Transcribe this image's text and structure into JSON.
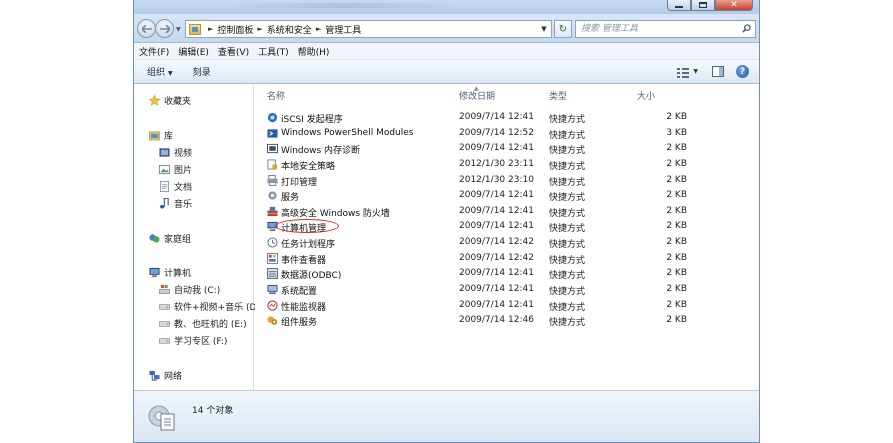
{
  "window": {
    "controls": {
      "minimize_icon": "minimize-icon",
      "maximize_icon": "maximize-icon",
      "close_icon": "close-icon",
      "close_glyph": "✕"
    }
  },
  "address": {
    "crumbs": [
      "控制面板",
      "系统和安全",
      "管理工具"
    ],
    "refresh_glyph": "↻"
  },
  "search": {
    "placeholder": "搜索 管理工具"
  },
  "menu": [
    "文件(F)",
    "编辑(E)",
    "查看(V)",
    "工具(T)",
    "帮助(H)"
  ],
  "toolbar": {
    "organize": "组织",
    "organize_arrow": "▼",
    "burn": "刻录",
    "view_arrow": "▼",
    "help_glyph": "?"
  },
  "sidebar": {
    "favorites": "收藏夹",
    "libraries": "库",
    "library_items": [
      "视频",
      "图片",
      "文档",
      "音乐"
    ],
    "homegroup": "家庭组",
    "computer": "计算机",
    "drives": [
      "自动我 (C:)",
      "软件+视频+音乐 (D",
      "教、也旺机的 (E:)",
      "学习专区 (F:)"
    ],
    "network": "网络"
  },
  "columns": {
    "name": "名称",
    "date": "修改日期",
    "type": "类型",
    "size": "大小",
    "sort_arrow": "▲"
  },
  "files": [
    {
      "name": "iSCSI 发起程序",
      "date": "2009/7/14 12:41",
      "type": "快捷方式",
      "size": "2 KB",
      "icon": "iscsi-icon"
    },
    {
      "name": "Windows PowerShell Modules",
      "date": "2009/7/14 12:52",
      "type": "快捷方式",
      "size": "3 KB",
      "icon": "powershell-icon"
    },
    {
      "name": "Windows 内存诊断",
      "date": "2009/7/14 12:41",
      "type": "快捷方式",
      "size": "2 KB",
      "icon": "memory-diagnostic-icon"
    },
    {
      "name": "本地安全策略",
      "date": "2012/1/30 23:11",
      "type": "快捷方式",
      "size": "2 KB",
      "icon": "security-policy-icon"
    },
    {
      "name": "打印管理",
      "date": "2012/1/30 23:10",
      "type": "快捷方式",
      "size": "2 KB",
      "icon": "printer-icon"
    },
    {
      "name": "服务",
      "date": "2009/7/14 12:41",
      "type": "快捷方式",
      "size": "2 KB",
      "icon": "services-gear-icon"
    },
    {
      "name": "高级安全 Windows 防火墙",
      "date": "2009/7/14 12:41",
      "type": "快捷方式",
      "size": "2 KB",
      "icon": "firewall-icon"
    },
    {
      "name": "计算机管理",
      "date": "2009/7/14 12:41",
      "type": "快捷方式",
      "size": "2 KB",
      "icon": "computer-management-icon"
    },
    {
      "name": "任务计划程序",
      "date": "2009/7/14 12:42",
      "type": "快捷方式",
      "size": "2 KB",
      "icon": "task-scheduler-icon"
    },
    {
      "name": "事件查看器",
      "date": "2009/7/14 12:42",
      "type": "快捷方式",
      "size": "2 KB",
      "icon": "event-viewer-icon"
    },
    {
      "name": "数据源(ODBC)",
      "date": "2009/7/14 12:41",
      "type": "快捷方式",
      "size": "2 KB",
      "icon": "odbc-icon"
    },
    {
      "name": "系统配置",
      "date": "2009/7/14 12:41",
      "type": "快捷方式",
      "size": "2 KB",
      "icon": "system-config-icon"
    },
    {
      "name": "性能监视器",
      "date": "2009/7/14 12:41",
      "type": "快捷方式",
      "size": "2 KB",
      "icon": "performance-monitor-icon"
    },
    {
      "name": "组件服务",
      "date": "2009/7/14 12:46",
      "type": "快捷方式",
      "size": "2 KB",
      "icon": "component-services-icon"
    }
  ],
  "status": {
    "count": "14 个对象"
  },
  "colors": {
    "title_bar": "#c6dbf2",
    "command_bar": "#dce7f4",
    "highlight_circle": "#d3302c",
    "header_text": "#4c607a"
  }
}
